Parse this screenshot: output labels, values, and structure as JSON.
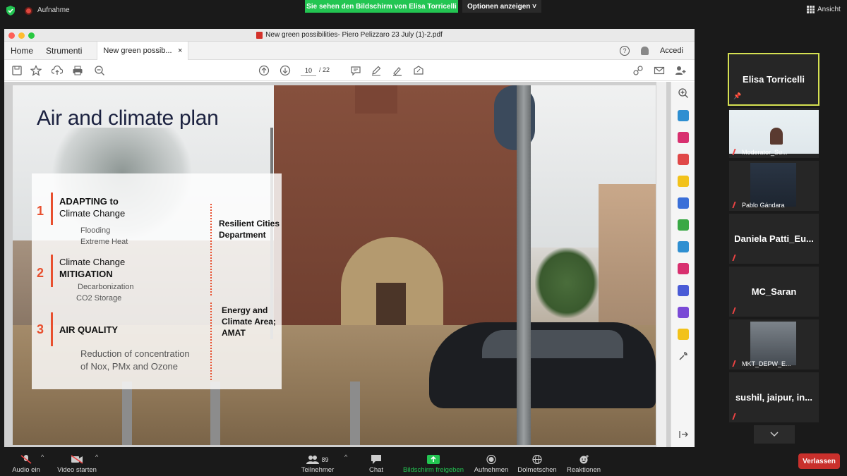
{
  "zoom": {
    "recording_label": "Aufnahme",
    "share_banner": "Sie sehen den Bildschirm von Elisa Torricelli",
    "options_label": "Optionen anzeigen ˅",
    "view_label": "Ansicht",
    "participants_count": "89",
    "controls": {
      "audio": "Audio ein",
      "video": "Video starten",
      "participants": "Teilnehmer",
      "chat": "Chat",
      "share": "Bildschirm freigeben",
      "record": "Aufnehmen",
      "interpret": "Dolmetschen",
      "reactions": "Reaktionen",
      "leave": "Verlassen"
    },
    "gallery": [
      {
        "name": "Elisa Torricelli",
        "style": "name-only",
        "active": true
      },
      {
        "name": "Moderator_Su...",
        "style": "video"
      },
      {
        "name": "Pablo Gándara",
        "style": "video"
      },
      {
        "name": "Daniela  Patti_Eu...",
        "style": "name-only"
      },
      {
        "name": "MC_Saran",
        "style": "name-only"
      },
      {
        "name": "MKT_DEPW_E...",
        "style": "video"
      },
      {
        "name": "sushil,  jaipur,  in...",
        "style": "name-only"
      }
    ]
  },
  "acrobat": {
    "window_title": "New green possibilities- Piero Pelizzaro 23 July (1)-2.pdf",
    "nav_home": "Home",
    "nav_tools": "Strumenti",
    "doc_tab": "New green possib...",
    "doc_tab_close": "×",
    "sign_in": "Accedi",
    "page_current": "10",
    "page_total": "/ 22"
  },
  "slide": {
    "title": "Air and climate plan",
    "items": [
      {
        "num": "1",
        "head_bold": "ADAPTING  to",
        "head_rest": "Climate Change",
        "subs": [
          "Flooding",
          "Extreme Heat"
        ]
      },
      {
        "num": "2",
        "head_bold": "MITIGATION",
        "head_pre": "Climate Change",
        "subs": [
          "Decarbonization",
          "CO2 Storage"
        ]
      },
      {
        "num": "3",
        "head_bold": "AIR QUALITY",
        "subs": [
          "Reduction  of concentration",
          "of Nox, PMx and Ozone"
        ]
      }
    ],
    "side_labels": [
      "Resilient Cities\nDepartment",
      "Energy and\nClimate Area;\nAMAT"
    ],
    "accent": "#e8502f"
  },
  "colors": {
    "zoom_green": "#23c552",
    "leave_red": "#c9302c",
    "active_border": "#d5e052"
  }
}
